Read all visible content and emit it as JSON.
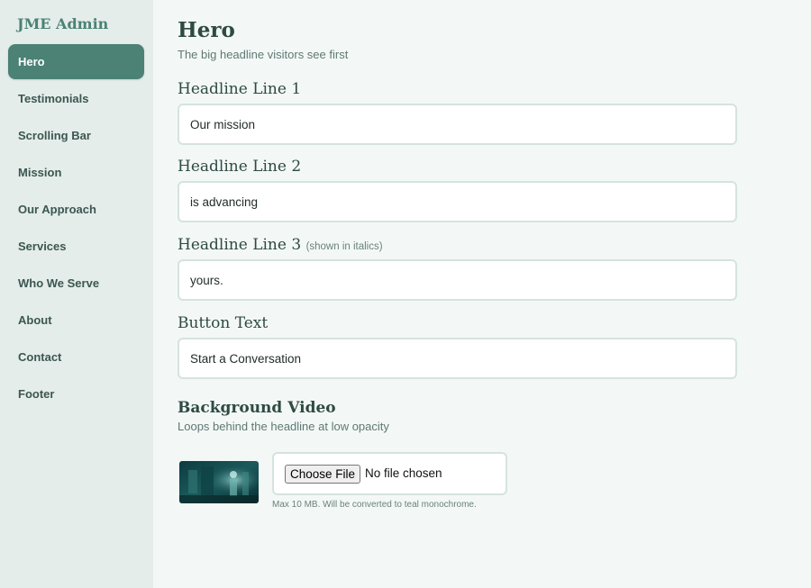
{
  "brand": "JME Admin",
  "sidebar": {
    "items": [
      {
        "label": "Hero"
      },
      {
        "label": "Testimonials"
      },
      {
        "label": "Scrolling Bar"
      },
      {
        "label": "Mission"
      },
      {
        "label": "Our Approach"
      },
      {
        "label": "Services"
      },
      {
        "label": "Who We Serve"
      },
      {
        "label": "About"
      },
      {
        "label": "Contact"
      },
      {
        "label": "Footer"
      }
    ],
    "active_index": 0
  },
  "main": {
    "title": "Hero",
    "subtitle": "The big headline visitors see first",
    "fields": [
      {
        "label": "Headline Line 1",
        "note": "",
        "value": "Our mission"
      },
      {
        "label": "Headline Line 2",
        "note": "",
        "value": "is advancing"
      },
      {
        "label": "Headline Line 3",
        "note": "(shown in italics)",
        "value": "yours."
      },
      {
        "label": "Button Text",
        "note": "",
        "value": "Start a Conversation"
      }
    ],
    "video": {
      "title": "Background Video",
      "subtitle": "Loops behind the headline at low opacity",
      "choose_label": "Choose File",
      "file_status": "No file chosen",
      "hint": "Max 10 MB. Will be converted to teal monochrome."
    }
  },
  "colors": {
    "accent": "#4b8275",
    "sidebar_bg": "#e4edea",
    "page_bg": "#f3f8f6",
    "heading": "#2e4a43"
  }
}
